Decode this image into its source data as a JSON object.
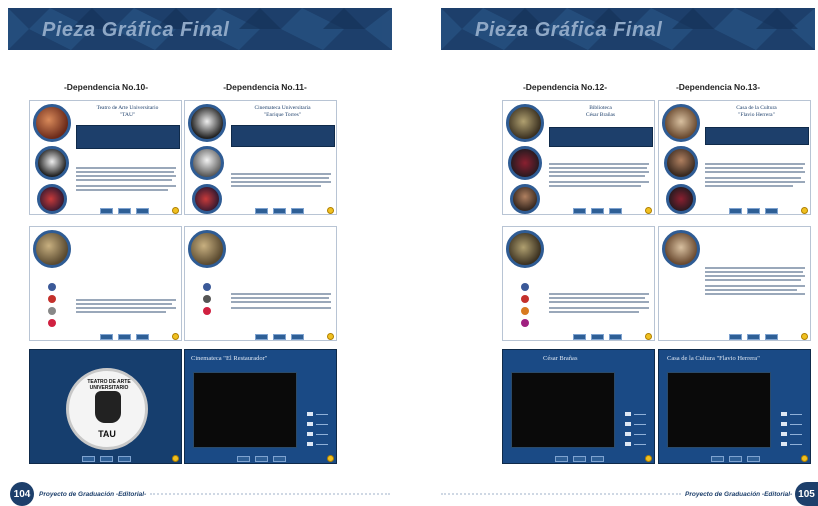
{
  "banner": {
    "title": "Pieza Gráfica Final"
  },
  "left_page": {
    "headings": [
      "-Dependencia No.10-",
      "-Dependencia No.11-"
    ],
    "cards": {
      "tau_title": "Teatro de Arte Universitario\n\"TAU\"",
      "cine_title": "Cinemateca Universitaria\n\"Enrique Torres\"",
      "tau_logo_text": "TEATRO DE ARTE UNIVERSITARIO",
      "tau_logo_sub": "TAU",
      "video_title": "Cinemateca \"El Restaurador\""
    },
    "page_number": "104",
    "footer": "Proyecto de Graduación -Editorial-"
  },
  "right_page": {
    "headings": [
      "-Dependencia No.12-",
      "-Dependencia No.13-"
    ],
    "cards": {
      "biblio_title": "Biblioteca\nCésar Brañas",
      "casa_title": "Casa de la Cultura\n\"Flavio Herrera\"",
      "video_title_1": "César Brañas",
      "video_title_2": "Casa de la Cultura \"Flavio Herrera\""
    },
    "page_number": "105",
    "footer": "Proyecto de Graduación -Editorial-"
  }
}
